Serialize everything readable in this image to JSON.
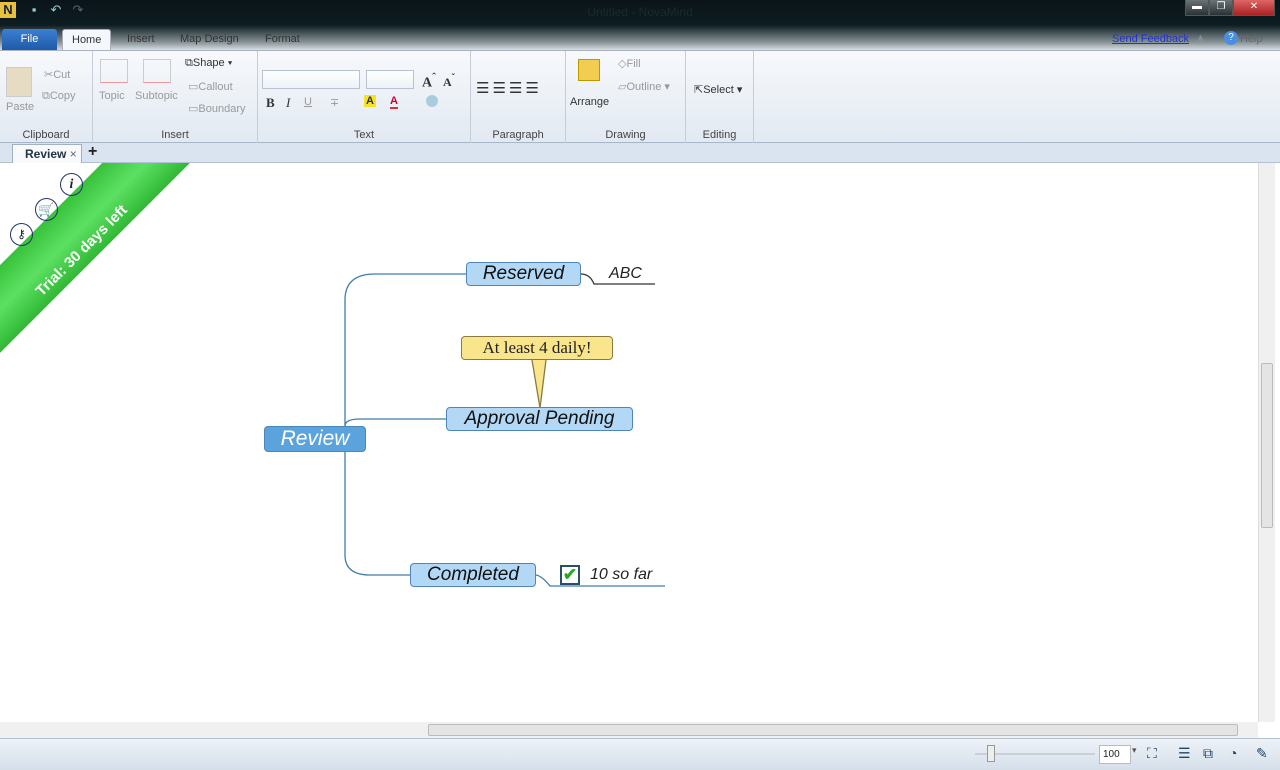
{
  "window": {
    "title": "Untitled - NovaMind",
    "controls": [
      "minimize",
      "restore",
      "close"
    ]
  },
  "quick_access": [
    "app-icon",
    "save-icon",
    "undo-icon",
    "redo-icon"
  ],
  "ribbon_tabs": {
    "file": "File",
    "home": "Home",
    "insert": "Insert",
    "map_design": "Map Design",
    "format": "Format"
  },
  "top_right": {
    "feedback": "Send Feedback",
    "help": "Help"
  },
  "ribbon": {
    "clipboard": {
      "label": "Clipboard",
      "paste": "Paste",
      "cut": "Cut",
      "copy": "Copy"
    },
    "insert": {
      "label": "Insert",
      "topic": "Topic",
      "subtopic": "Subtopic",
      "shape": "Shape",
      "callout": "Callout",
      "boundary": "Boundary"
    },
    "text": {
      "label": "Text",
      "font_value": "",
      "size_value": "",
      "bold": "B",
      "italic": "I",
      "underline": "U",
      "highlight": "A",
      "font_color": "A"
    },
    "paragraph": {
      "label": "Paragraph"
    },
    "drawing": {
      "label": "Drawing",
      "arrange": "Arrange",
      "fill": "Fill",
      "outline": "Outline"
    },
    "editing": {
      "label": "Editing",
      "select": "Select"
    }
  },
  "doc_tab": {
    "label": "Review",
    "close": "×",
    "add": "+"
  },
  "trial": {
    "text": "Trial: 30 days left",
    "icons": [
      "info-icon",
      "cart-icon",
      "key-icon"
    ]
  },
  "map": {
    "central": "Review",
    "topics": [
      {
        "label": "Reserved",
        "note": "ABC"
      },
      {
        "label": "Approval Pending",
        "callout": "At least 4 daily!"
      },
      {
        "label": "Completed",
        "note": "10 so far",
        "checked": true
      }
    ],
    "colors": {
      "central": "#5ba3dc",
      "topic": "#b3d8f6",
      "callout": "#f8e58c",
      "line": "#3f7ea8"
    }
  },
  "status": {
    "zoom": "100"
  }
}
